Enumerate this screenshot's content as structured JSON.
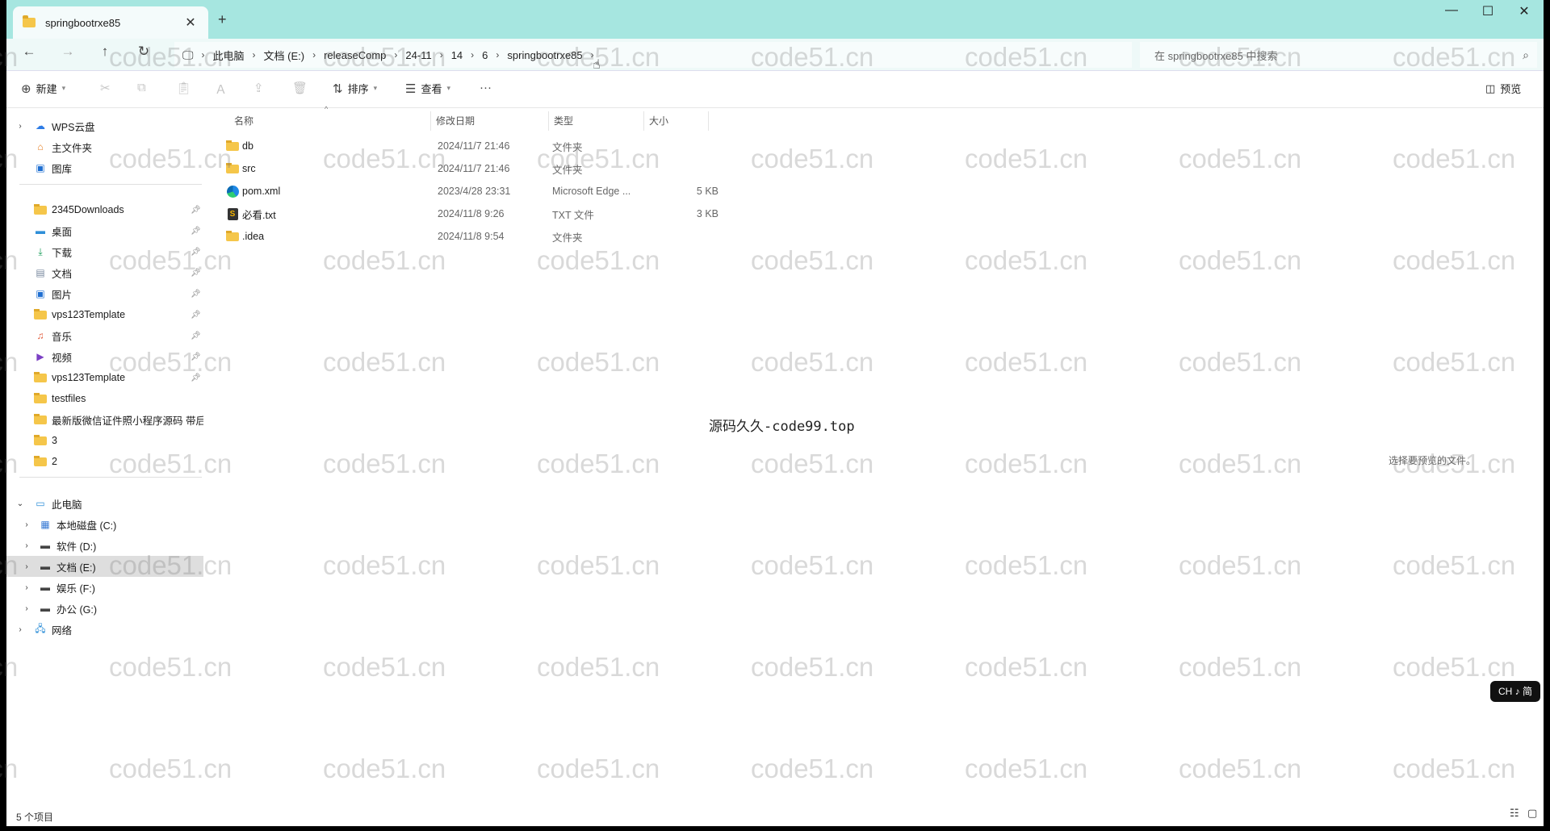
{
  "window": {
    "tab_title": "springbootrxe85",
    "new_tab": "+",
    "minimize": "—",
    "maximize": "☐",
    "close": "✕"
  },
  "nav": {
    "back": "←",
    "forward": "→",
    "up": "↑",
    "refresh": "↻",
    "breadcrumbs": [
      "此电脑",
      "文档 (E:)",
      "releaseComp",
      "24-11",
      "14",
      "6",
      "springbootrxe85"
    ],
    "search_placeholder": "在 springbootrxe85 中搜索"
  },
  "toolbar": {
    "new_label": "新建",
    "sort_label": "排序",
    "view_label": "查看",
    "more_label": "···",
    "preview_label": "预览"
  },
  "sidebar": {
    "top": [
      {
        "label": "WPS云盘",
        "icon": "cloud-icon"
      },
      {
        "label": "主文件夹",
        "icon": "home-icon"
      },
      {
        "label": "图库",
        "icon": "gallery-icon"
      }
    ],
    "pinned": [
      {
        "label": "2345Downloads",
        "icon": "folder-icon"
      },
      {
        "label": "桌面",
        "icon": "desktop-icon"
      },
      {
        "label": "下载",
        "icon": "download-icon"
      },
      {
        "label": "文档",
        "icon": "document-icon"
      },
      {
        "label": "图片",
        "icon": "pictures-icon"
      },
      {
        "label": "vps123Template",
        "icon": "folder-icon"
      },
      {
        "label": "音乐",
        "icon": "music-icon"
      },
      {
        "label": "视频",
        "icon": "video-icon"
      },
      {
        "label": "vps123Template",
        "icon": "folder-icon"
      },
      {
        "label": "testfiles",
        "icon": "folder-icon"
      },
      {
        "label": "最新版微信证件照小程序源码 带后台",
        "icon": "folder-icon"
      },
      {
        "label": "3",
        "icon": "folder-icon"
      },
      {
        "label": "2",
        "icon": "folder-icon"
      }
    ],
    "this_pc": "此电脑",
    "drives": [
      {
        "label": "本地磁盘 (C:)"
      },
      {
        "label": "软件 (D:)"
      },
      {
        "label": "文档 (E:)"
      },
      {
        "label": "娱乐 (F:)"
      },
      {
        "label": "办公 (G:)"
      }
    ],
    "network": "网络"
  },
  "columns": {
    "name": "名称",
    "date": "修改日期",
    "type": "类型",
    "size": "大小"
  },
  "files": [
    {
      "name": "db",
      "date": "2024/11/7 21:46",
      "type": "文件夹",
      "size": "",
      "icon": "folder-icon"
    },
    {
      "name": "src",
      "date": "2024/11/7 21:46",
      "type": "文件夹",
      "size": "",
      "icon": "folder-icon"
    },
    {
      "name": "pom.xml",
      "date": "2023/4/28 23:31",
      "type": "Microsoft Edge ...",
      "size": "5 KB",
      "icon": "edge-icon"
    },
    {
      "name": "必看.txt",
      "date": "2024/11/8 9:26",
      "type": "TXT 文件",
      "size": "3 KB",
      "icon": "text-file-icon"
    },
    {
      "name": ".idea",
      "date": "2024/11/8 9:54",
      "type": "文件夹",
      "size": "",
      "icon": "folder-icon"
    }
  ],
  "overlay_text": "源码久久-code99.top",
  "preview_hint": "选择要预览的文件。",
  "status": "5 个项目",
  "ime": "CH ♪ 简",
  "watermark": "code51.cn",
  "colors": {
    "titlebar": "#a6e6e0",
    "selected": "#dedede",
    "folder": "#f5c64a"
  }
}
